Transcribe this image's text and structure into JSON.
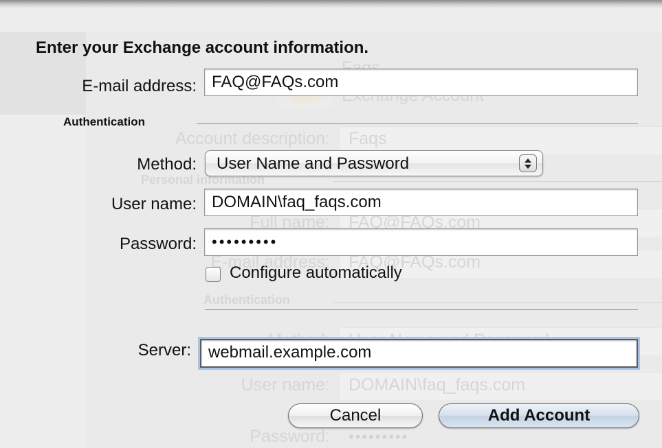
{
  "dialog": {
    "heading": "Enter your Exchange account information.",
    "email_label": "E-mail address:",
    "email_value": "FAQ@FAQs.com",
    "auth_section": "Authentication",
    "method_label": "Method:",
    "method_value": "User Name and Password",
    "username_label": "User name:",
    "username_value": "DOMAIN\\faq_faqs.com",
    "password_label": "Password:",
    "password_value": "•••••••••",
    "configure_label": "Configure automatically",
    "configure_checked": false,
    "server_label": "Server:",
    "server_value": "webmail.example.com",
    "cancel_label": "Cancel",
    "add_label": "Add Account"
  },
  "background_window": {
    "account_title": "Faqs",
    "account_type": "Exchange Account",
    "description_label": "Account description:",
    "description_value": "Faqs",
    "personal_info": "Personal information",
    "full_name_label": "Full name:",
    "full_name_value": "FAQ@FAQs.com",
    "email_label": "E-mail address:",
    "email_value": "FAQ@FAQs.com",
    "auth_section": "Authentication",
    "method_label": "Method:",
    "method_value": "User Name and Password",
    "username_label": "User name:",
    "username_value": "DOMAIN\\faq_faqs.com",
    "password_label": "Password:",
    "password_value": "•••••••••"
  },
  "colors": {
    "focus_ring": "#a9c3e2",
    "primary_button": "#c4d1e2",
    "background": "#ededed"
  }
}
